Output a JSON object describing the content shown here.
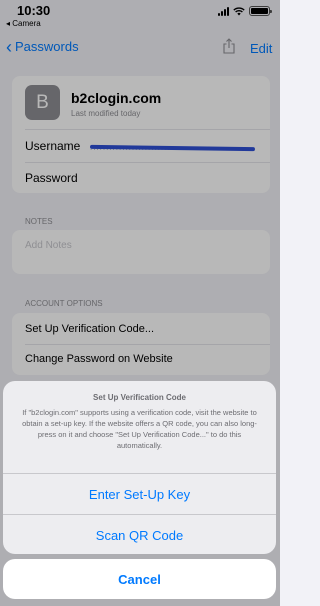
{
  "status_bar": {
    "time": "10:30",
    "back_app": "◂ Camera"
  },
  "nav": {
    "back_label": "Passwords",
    "edit_label": "Edit"
  },
  "account": {
    "avatar_letter": "B",
    "site": "b2clogin.com",
    "modified": "Last modified today",
    "username_label": "Username",
    "password_label": "Password"
  },
  "notes": {
    "header": "NOTES",
    "placeholder": "Add Notes"
  },
  "options": {
    "header": "ACCOUNT OPTIONS",
    "items": [
      "Set Up Verification Code...",
      "Change Password on Website"
    ]
  },
  "sheet": {
    "title": "Set Up Verification Code",
    "message": "If \"b2clogin.com\" supports using a verification code, visit the website to obtain a set-up key. If the website offers a QR code, you can also long-press on it and choose \"Set Up Verification Code...\" to do this automatically.",
    "actions": [
      "Enter Set-Up Key",
      "Scan QR Code"
    ],
    "cancel": "Cancel"
  },
  "colors": {
    "accent": "#007aff",
    "background": "#f2f2f7"
  }
}
